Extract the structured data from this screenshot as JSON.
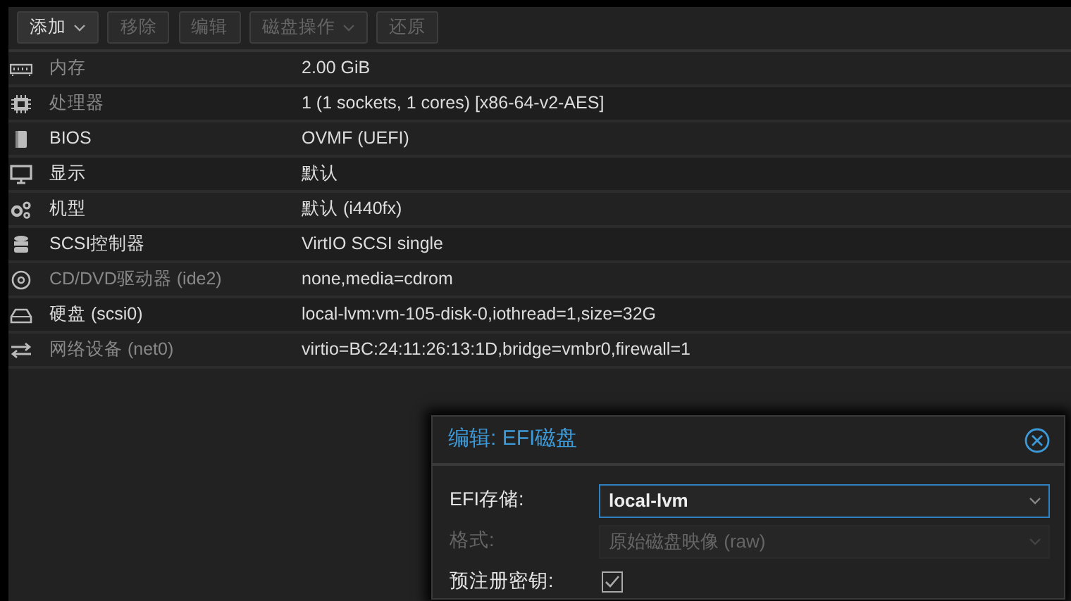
{
  "toolbar": [
    {
      "label": "添加",
      "disabled": false,
      "dropdown": true
    },
    {
      "label": "移除",
      "disabled": true,
      "dropdown": false
    },
    {
      "label": "编辑",
      "disabled": true,
      "dropdown": false
    },
    {
      "label": "磁盘操作",
      "disabled": true,
      "dropdown": true
    },
    {
      "label": "还原",
      "disabled": true,
      "dropdown": false
    }
  ],
  "rows": [
    {
      "kind": "memory",
      "label": "内存",
      "value": "2.00 GiB",
      "dimmed": true
    },
    {
      "kind": "cpu",
      "label": "处理器",
      "value": "1 (1 sockets, 1 cores) [x86-64-v2-AES]",
      "dimmed": true
    },
    {
      "kind": "bios",
      "label": "BIOS",
      "value": "OVMF (UEFI)",
      "dimmed": false
    },
    {
      "kind": "display",
      "label": "显示",
      "value": "默认",
      "dimmed": false
    },
    {
      "kind": "machine",
      "label": "机型",
      "value": "默认 (i440fx)",
      "dimmed": false
    },
    {
      "kind": "scsi",
      "label": "SCSI控制器",
      "value": "VirtIO SCSI single",
      "dimmed": false
    },
    {
      "kind": "cdrom",
      "label": "CD/DVD驱动器 (ide2)",
      "value": "none,media=cdrom",
      "dimmed": true
    },
    {
      "kind": "disk",
      "label": "硬盘 (scsi0)",
      "value": "local-lvm:vm-105-disk-0,iothread=1,size=32G",
      "dimmed": false
    },
    {
      "kind": "network",
      "label": "网络设备 (net0)",
      "value": "virtio=BC:24:11:26:13:1D,bridge=vmbr0,firewall=1",
      "dimmed": true
    }
  ],
  "dialog": {
    "title": "编辑: EFI磁盘",
    "fields": [
      {
        "kind": "combo",
        "label": "EFI存储:",
        "value": "local-lvm",
        "disabled": false,
        "focused": true
      },
      {
        "kind": "combo",
        "label": "格式:",
        "value": "原始磁盘映像 (raw)",
        "disabled": true,
        "focused": false
      },
      {
        "kind": "checkbox",
        "label": "预注册密钥:",
        "checked": true,
        "disabled": false
      }
    ]
  }
}
